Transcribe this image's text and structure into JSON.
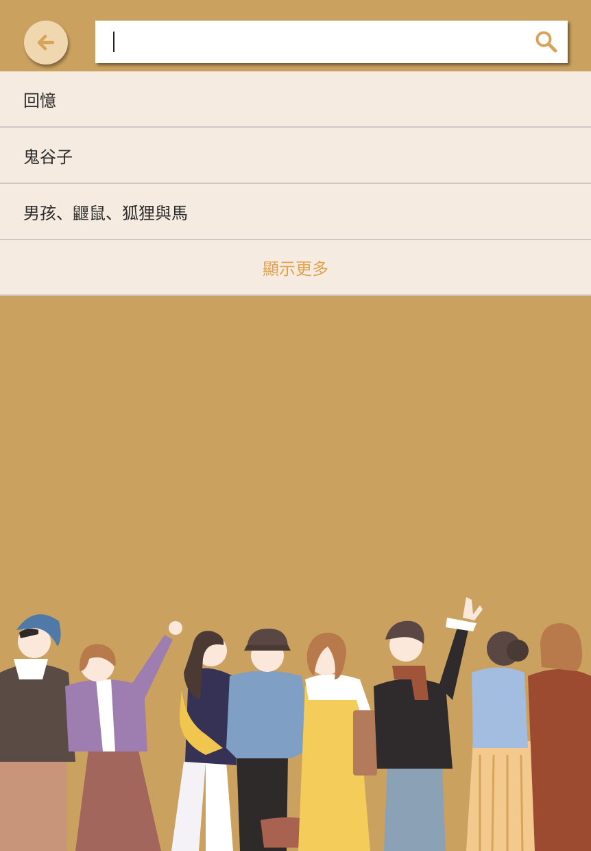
{
  "search": {
    "value": "",
    "placeholder": ""
  },
  "suggestions": [
    {
      "label": "回憶"
    },
    {
      "label": "鬼谷子"
    },
    {
      "label": "男孩、鼴鼠、狐狸與馬"
    }
  ],
  "show_more_label": "顯示更多",
  "icons": {
    "back": "arrow-left-icon",
    "search": "magnifier-icon"
  },
  "colors": {
    "background": "#caa15f",
    "back_button": "#f0d7b0",
    "accent": "#e0a24e",
    "list_bg": "#f5ebe0",
    "divider": "#cfc6c5"
  }
}
